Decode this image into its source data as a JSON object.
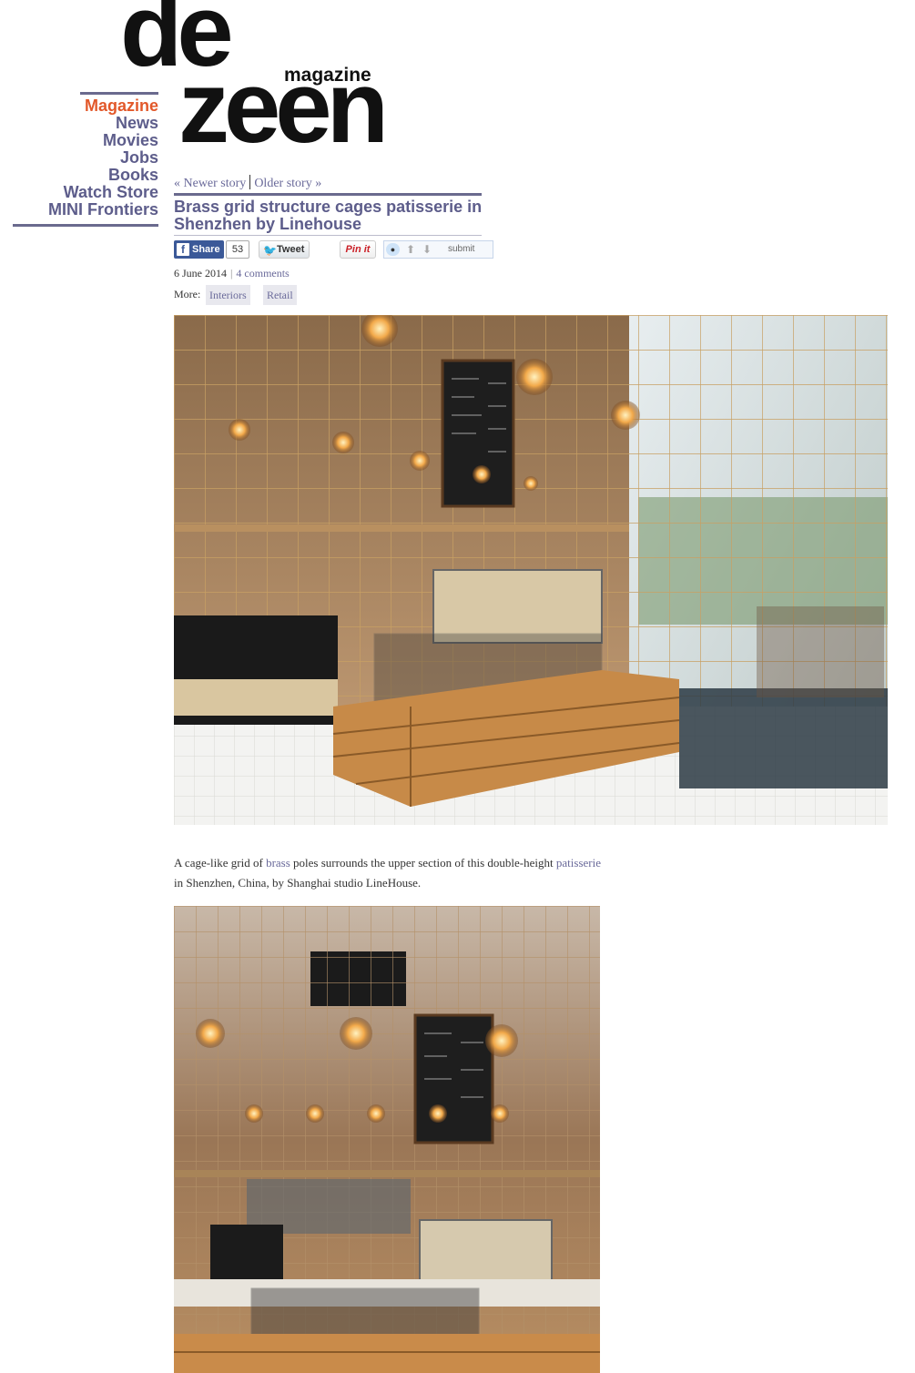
{
  "logo": {
    "line1": "de",
    "line2": "zeen",
    "sub": "magazine"
  },
  "nav": {
    "items": [
      {
        "label": "Magazine",
        "active": true
      },
      {
        "label": "News"
      },
      {
        "label": "Movies"
      },
      {
        "label": "Jobs"
      },
      {
        "label": "Books"
      },
      {
        "label": "Watch Store"
      },
      {
        "label": "MINI Frontiers"
      }
    ]
  },
  "story_nav": {
    "newer": "« Newer story",
    "older": "Older story »"
  },
  "article": {
    "title": "Brass grid structure cages patisserie in Shenzhen by Linehouse",
    "date": "6 June 2014",
    "comments": "4 comments",
    "more_label": "More:",
    "tags": [
      "Interiors",
      "Retail"
    ],
    "body_parts": {
      "p1": "A cage-like grid of ",
      "link1": "brass",
      "p2": " poles surrounds the upper section of this double-height ",
      "link2": "patisserie",
      "p3": " in Shenzhen, China, by Shanghai studio LineHouse."
    }
  },
  "share": {
    "facebook_label": "Share",
    "facebook_count": "53",
    "tweet_label": "Tweet",
    "pin_label": "Pin it",
    "reddit_label": "submit"
  },
  "colors": {
    "accent": "#e2582a",
    "nav": "#5d5d8b",
    "link": "#6a6a9a"
  },
  "photos": [
    {
      "name": "Patisserie interior with brass grid, wooden counter and chalkboard menu"
    },
    {
      "name": "Front view of patisserie with hanging bulb lights and display counter"
    }
  ]
}
